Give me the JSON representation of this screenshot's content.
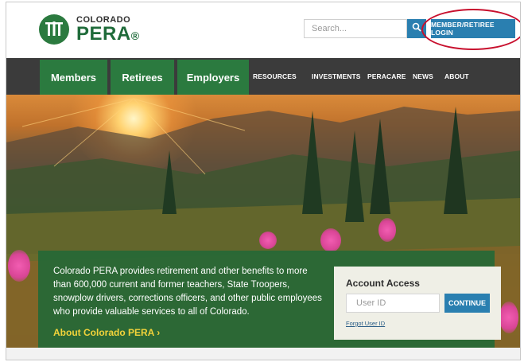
{
  "header": {
    "logo_small": "COLORADO",
    "logo_big": "PERA",
    "search_placeholder": "Search...",
    "search_icon": "search-icon",
    "login_label": "MEMBER/RETIREE LOGIN"
  },
  "nav": {
    "primary": [
      "Members",
      "Retirees",
      "Employers"
    ],
    "secondary": [
      "RESOURCES",
      "INVESTMENTS",
      "PERACARE",
      "NEWS",
      "ABOUT"
    ]
  },
  "hero": {
    "description": "Colorado PERA provides retirement and other benefits to more than 600,000 current and former teachers, State Troopers, snowplow drivers, corrections officers, and other public employees who provide valuable services to all of Colorado.",
    "about_link": "About Colorado PERA ›"
  },
  "account": {
    "title": "Account Access",
    "userid_placeholder": "User ID",
    "continue_label": "CONTINUE",
    "forgot_label": "Forgot User ID"
  },
  "colors": {
    "brand_green": "#2b7a3f",
    "nav_dark": "#3b3b3b",
    "action_blue": "#2a7fb0",
    "link_yellow": "#f2d33a",
    "highlight_red": "#c8102e"
  }
}
